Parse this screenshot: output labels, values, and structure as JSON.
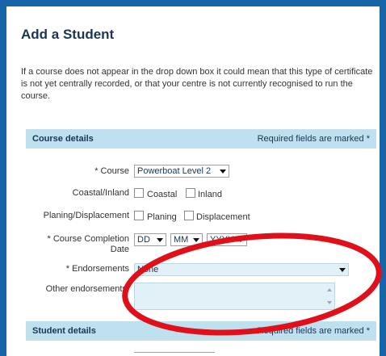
{
  "page": {
    "title": "Add a Student",
    "intro": "If a course does not appear in the drop down box it could mean that this type of certificate is not yet centrally recorded, or that your centre is not currently recognised to run the course."
  },
  "course_section": {
    "title": "Course details",
    "required_note": "Required fields are marked *"
  },
  "form": {
    "course_label": "* Course",
    "course_value": "Powerboat Level 2",
    "coastal_label": "Coastal/Inland",
    "coastal_option": "Coastal",
    "inland_option": "Inland",
    "planing_label": "Planing/Displacement",
    "planing_option": "Planing",
    "displacement_option": "Displacement",
    "completion_label_1": "* Course Completion",
    "completion_label_2": "Date",
    "day_value": "DD",
    "month_value": "MM",
    "year_value": "YYYY",
    "endorsements_label": "* Endorsements",
    "endorsements_value": "None",
    "other_endorsements_label": "Other endorsements:"
  },
  "student_section": {
    "title": "Student details",
    "required_note": "Required fields are marked *"
  },
  "annotation": {
    "color": "#e0101a"
  }
}
